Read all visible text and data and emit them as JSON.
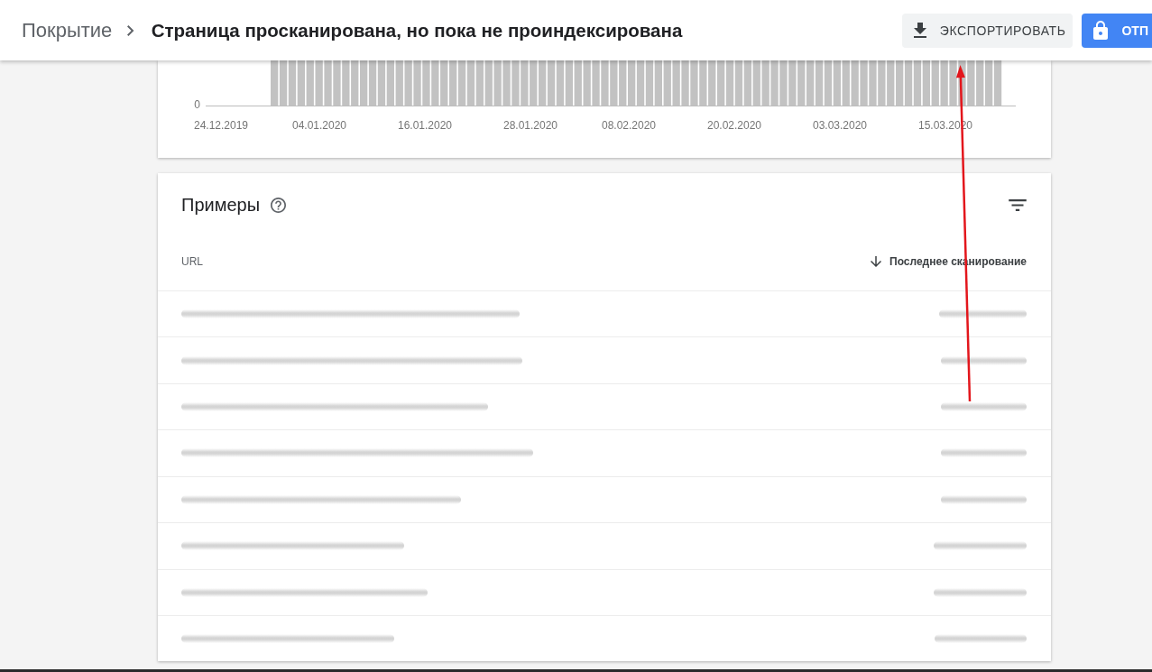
{
  "header": {
    "breadcrumb_parent": "Покрытие",
    "title": "Страница просканирована, но пока не проиндексирована",
    "buttons": [
      {
        "kind": "export",
        "label": "ЭКСПОРТИРОВАТЬ"
      },
      {
        "kind": "primary",
        "label": "ОТП"
      }
    ]
  },
  "chart": {
    "y_tick": "0",
    "x_ticks": [
      "24.12.2019",
      "04.01.2020",
      "16.01.2020",
      "28.01.2020",
      "08.02.2020",
      "20.02.2020",
      "03.03.2020",
      "15.03.2020"
    ]
  },
  "examples": {
    "title": "Примеры",
    "columns": [
      {
        "label": "URL",
        "sorted": false
      },
      {
        "label": "Последнее сканирование",
        "sorted": true
      }
    ],
    "rows": [
      {
        "blurred": true
      },
      {
        "blurred": true
      },
      {
        "blurred": true
      },
      {
        "blurred": true
      },
      {
        "blurred": true
      },
      {
        "blurred": true
      },
      {
        "blurred": true
      },
      {
        "blurred": true
      }
    ]
  }
}
